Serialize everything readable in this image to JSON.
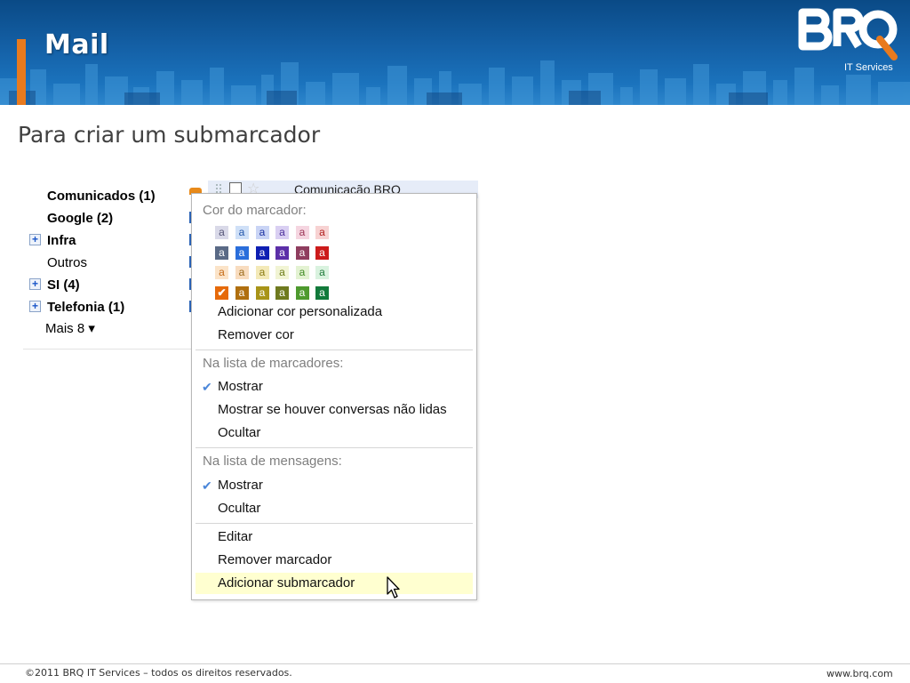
{
  "header": {
    "title": "Mail",
    "logo_text": "BRQ",
    "logo_tagline": "IT Services",
    "accent_color": "#e87a1e",
    "banner_color": "#1460a6"
  },
  "page_heading": "Para criar um submarcador",
  "labels": {
    "items": [
      {
        "label": "Comunicados (1)",
        "bold": true,
        "expander": false
      },
      {
        "label": "Google (2)",
        "bold": true,
        "expander": false
      },
      {
        "label": "Infra",
        "bold": true,
        "expander": true
      },
      {
        "label": "Outros",
        "bold": false,
        "expander": false
      },
      {
        "label": "SI (4)",
        "bold": true,
        "expander": true
      },
      {
        "label": "Telefonia (1)",
        "bold": true,
        "expander": true
      }
    ],
    "more": "Mais 8 ▾",
    "expander_symbol": "+"
  },
  "mail_row": {
    "sender": "Comunicação BRQ",
    "star": "☆"
  },
  "menu": {
    "color_section": "Cor do marcador:",
    "swatch_letter": "a",
    "swatches": [
      [
        {
          "bg": "#d9d9e8",
          "fg": "#555577"
        },
        {
          "bg": "#cfe0f7",
          "fg": "#2255aa"
        },
        {
          "bg": "#c9d4f5",
          "fg": "#1a2fa0"
        },
        {
          "bg": "#d9cff2",
          "fg": "#4a2d9a"
        },
        {
          "bg": "#f5d5e0",
          "fg": "#9a3355"
        },
        {
          "bg": "#f7d2d2",
          "fg": "#b01c1c"
        }
      ],
      [
        {
          "bg": "#5a6a86",
          "fg": "#ffffff"
        },
        {
          "bg": "#2a6edb",
          "fg": "#ffffff"
        },
        {
          "bg": "#0e1fb3",
          "fg": "#ffffff"
        },
        {
          "bg": "#5c2fa8",
          "fg": "#ffffff"
        },
        {
          "bg": "#8f3d5f",
          "fg": "#ffffff"
        },
        {
          "bg": "#cc1b1b",
          "fg": "#ffffff"
        }
      ],
      [
        {
          "bg": "#fbe3c8",
          "fg": "#c46a16"
        },
        {
          "bg": "#f8dcbf",
          "fg": "#9a6a1a"
        },
        {
          "bg": "#f3e9b8",
          "fg": "#8a7a12"
        },
        {
          "bg": "#f1f4d4",
          "fg": "#6a7a16"
        },
        {
          "bg": "#e3f2d2",
          "fg": "#3f8a22"
        },
        {
          "bg": "#d9f2df",
          "fg": "#1f7a3a"
        }
      ],
      [
        {
          "bg": "#e66a0a",
          "fg": "#ffffff",
          "checked": true
        },
        {
          "bg": "#b06f0f",
          "fg": "#ffffff"
        },
        {
          "bg": "#a89418",
          "fg": "#ffffff"
        },
        {
          "bg": "#6f7a1f",
          "fg": "#ffffff"
        },
        {
          "bg": "#4e9a2e",
          "fg": "#ffffff"
        },
        {
          "bg": "#127a3b",
          "fg": "#ffffff"
        }
      ]
    ],
    "add_custom_color": "Adicionar cor personalizada",
    "remove_color": "Remover cor",
    "label_list_section": "Na lista de marcadores:",
    "label_list_show": "Mostrar",
    "label_list_show_unread": "Mostrar se houver conversas não lidas",
    "label_list_hide": "Ocultar",
    "message_list_section": "Na lista de mensagens:",
    "message_list_show": "Mostrar",
    "message_list_hide": "Ocultar",
    "edit": "Editar",
    "remove_label": "Remover marcador",
    "add_sublabel": "Adicionar submarcador",
    "checkmark": "✔",
    "hover_color": "#ffffd0"
  },
  "footer": {
    "copyright": "©2011 BRQ IT Services – todos os direitos reservados.",
    "url": "www.brq.com"
  }
}
